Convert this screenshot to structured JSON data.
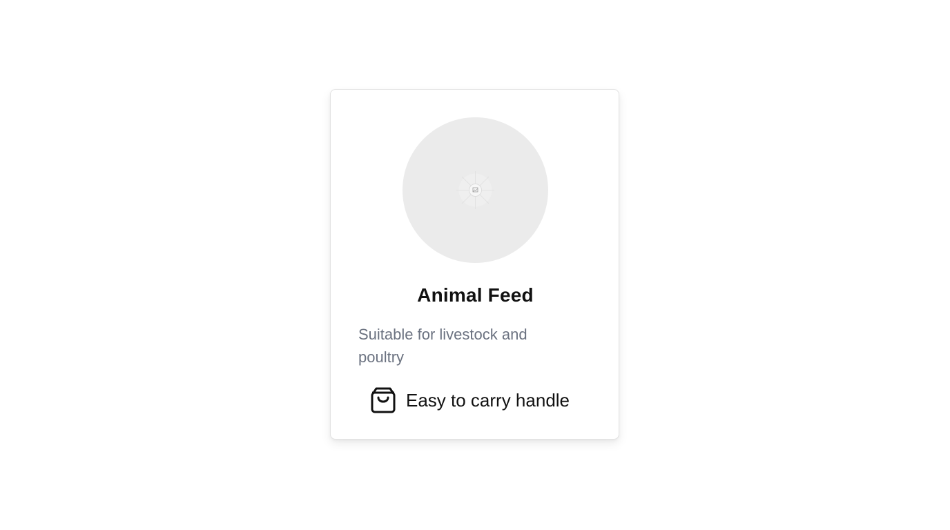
{
  "product": {
    "image_icon": "image-placeholder-icon",
    "title": "Animal Feed",
    "description": "Suitable for livestock and poultry",
    "feature": {
      "icon": "shopping-bag-icon",
      "label": "Easy to carry handle"
    }
  },
  "colors": {
    "card_border": "#e2e2e2",
    "image_bg": "#ebebeb",
    "title": "#111111",
    "description": "#6b7280"
  }
}
